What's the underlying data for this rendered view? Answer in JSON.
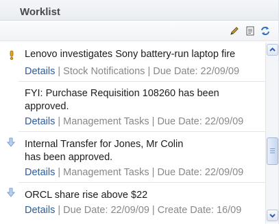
{
  "portlet": {
    "title": "Worklist"
  },
  "toolbar": {
    "icons": [
      "edit-icon",
      "view-icon",
      "refresh-icon"
    ]
  },
  "items": [
    {
      "icon": "priority-high-icon",
      "title": "Lenovo investigates Sony battery-run laptop fire",
      "link": "Details",
      "meta": " | Stock Notifications | Due Date: 22/09/09"
    },
    {
      "icon": "",
      "title_line1": "FYI: Purchase Requisition 108260 has been",
      "title_line2": "approved.",
      "link": "Details",
      "meta": " | Management Tasks | Due Date: 22/09/09"
    },
    {
      "icon": "priority-low-icon",
      "title_line1": "Internal Transfer for Jones, Mr Colin",
      "title_line2": "has been approved.",
      "link": "Details",
      "meta": " | Management Tasks | Due Date: 22/09/09"
    },
    {
      "icon": "priority-low-icon",
      "title": "ORCL share rise above $22",
      "link": "Details",
      "meta": " | Due Date: 22/09/09 | Create Date: 16/09"
    }
  ],
  "colors": {
    "link": "#2d5b9a",
    "meta": "#888888",
    "priority_high": "#e8a21c",
    "priority_low": "#7a9fd6"
  }
}
